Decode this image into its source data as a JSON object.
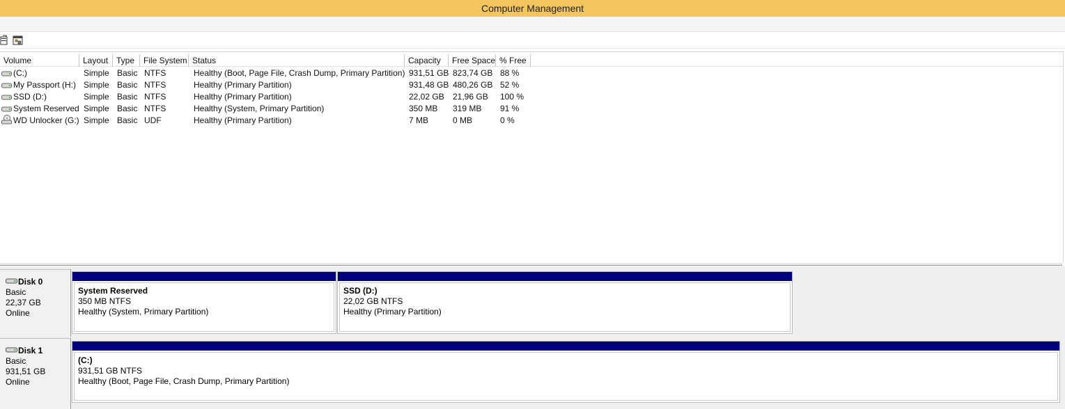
{
  "window": {
    "title": "Computer Management"
  },
  "toolbar": {
    "buttons": [
      {
        "icon": "properties-icon"
      },
      {
        "icon": "help-icon"
      }
    ]
  },
  "volume_list": {
    "columns": [
      "Volume",
      "Layout",
      "Type",
      "File System",
      "Status",
      "Capacity",
      "Free Space",
      "% Free"
    ],
    "rows": [
      {
        "volume": " (C:)",
        "layout": "Simple",
        "type": "Basic",
        "fs": "NTFS",
        "status": "Healthy (Boot, Page File, Crash Dump, Primary Partition)",
        "capacity": "931,51 GB",
        "free": "823,74 GB",
        "pct": "88 %",
        "icon": "drive-icon"
      },
      {
        "volume": "My Passport (H:)",
        "layout": "Simple",
        "type": "Basic",
        "fs": "NTFS",
        "status": "Healthy (Primary Partition)",
        "capacity": "931,48 GB",
        "free": "480,26 GB",
        "pct": "52 %",
        "icon": "drive-icon"
      },
      {
        "volume": "SSD (D:)",
        "layout": "Simple",
        "type": "Basic",
        "fs": "NTFS",
        "status": "Healthy (Primary Partition)",
        "capacity": "22,02 GB",
        "free": "21,96 GB",
        "pct": "100 %",
        "icon": "drive-icon"
      },
      {
        "volume": "System Reserved",
        "layout": "Simple",
        "type": "Basic",
        "fs": "NTFS",
        "status": "Healthy (System, Primary Partition)",
        "capacity": "350 MB",
        "free": "319 MB",
        "pct": "91 %",
        "icon": "drive-icon"
      },
      {
        "volume": "WD Unlocker (G:)",
        "layout": "Simple",
        "type": "Basic",
        "fs": "UDF",
        "status": "Healthy (Primary Partition)",
        "capacity": "7 MB",
        "free": "0 MB",
        "pct": "0 %",
        "icon": "cd-drive-icon"
      }
    ]
  },
  "disks": [
    {
      "name": "Disk 0",
      "kind": "Basic",
      "size": "22,37 GB",
      "state": "Online",
      "partitions": [
        {
          "name": "System Reserved",
          "size": "350 MB NTFS",
          "status": "Healthy (System, Primary Partition)"
        },
        {
          "name": "SSD  (D:)",
          "size": "22,02 GB NTFS",
          "status": "Healthy (Primary Partition)"
        }
      ]
    },
    {
      "name": "Disk 1",
      "kind": "Basic",
      "size": "931,51 GB",
      "state": "Online",
      "partitions": [
        {
          "name": " (C:)",
          "size": "931,51 GB NTFS",
          "status": "Healthy (Boot, Page File, Crash Dump, Primary Partition)"
        }
      ]
    }
  ],
  "colors": {
    "titlebar": "#f2c55e",
    "partition_bar": "#000080"
  }
}
